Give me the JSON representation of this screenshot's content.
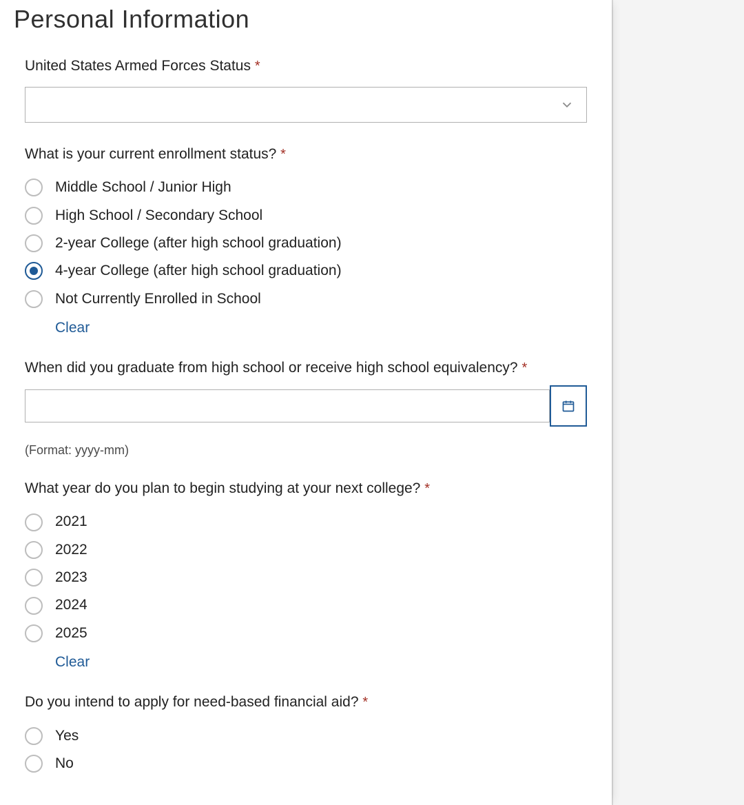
{
  "header": {
    "title": "Personal Information"
  },
  "fields": {
    "armed_forces": {
      "label": "United States Armed Forces Status",
      "required_mark": "*",
      "value": ""
    },
    "enrollment": {
      "label": "What is your current enrollment status?",
      "required_mark": "*",
      "options": [
        "Middle School / Junior High",
        "High School / Secondary School",
        "2-year College (after high school graduation)",
        "4-year College (after high school graduation)",
        "Not Currently Enrolled in School"
      ],
      "selected_index": 3,
      "clear_label": "Clear"
    },
    "hs_grad": {
      "label": "When did you graduate from high school or receive high school equivalency?",
      "required_mark": "*",
      "value": "",
      "hint": "(Format: yyyy-mm)"
    },
    "start_year": {
      "label": "What year do you plan to begin studying at your next college?",
      "required_mark": "*",
      "options": [
        "2021",
        "2022",
        "2023",
        "2024",
        "2025"
      ],
      "selected_index": -1,
      "clear_label": "Clear"
    },
    "fin_aid": {
      "label": "Do you intend to apply for need-based financial aid?",
      "required_mark": "*",
      "options": [
        "Yes",
        "No"
      ],
      "selected_index": -1
    }
  }
}
